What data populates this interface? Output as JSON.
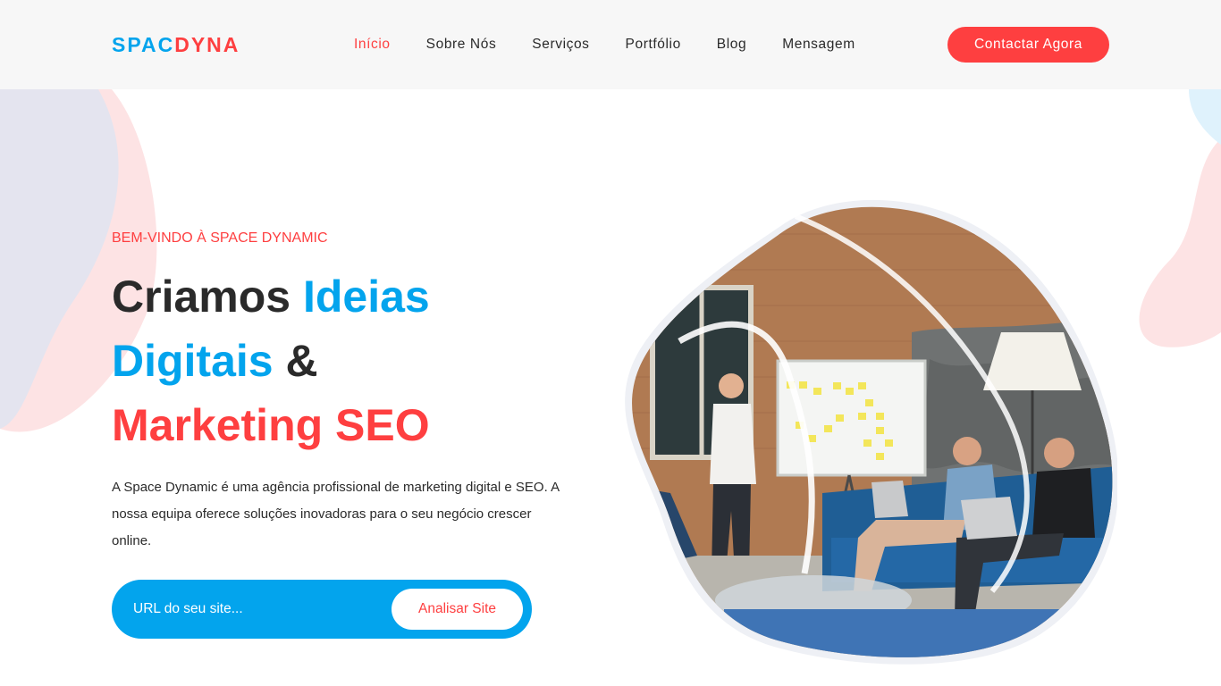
{
  "brand": {
    "logo_part1": "SPAC",
    "logo_part2": "DYNA"
  },
  "nav": {
    "items": [
      {
        "label": "Início",
        "active": true
      },
      {
        "label": "Sobre Nós",
        "active": false
      },
      {
        "label": "Serviços",
        "active": false
      },
      {
        "label": "Portfólio",
        "active": false
      },
      {
        "label": "Blog",
        "active": false
      },
      {
        "label": "Mensagem",
        "active": false
      }
    ],
    "cta_label": "Contactar Agora"
  },
  "hero": {
    "eyebrow": "BEM-VINDO À SPACE DYNAMIC",
    "title": {
      "part1": "Criamos ",
      "part2": "Ideias",
      "part3": "Digitais",
      "part4": " &",
      "part5": "Marketing SEO"
    },
    "description": "A Space Dynamic é uma agência profissional de marketing digital e SEO. A nossa equipa oferece soluções inovadoras para o seu negócio crescer online.",
    "form": {
      "placeholder": "URL do seu site...",
      "button_label": "Analisar Site"
    }
  },
  "colors": {
    "accent_red": "#fe3f40",
    "accent_blue": "#03a4ed",
    "text_dark": "#2a2a2a",
    "header_bg": "#f7f7f7"
  },
  "icons": {
    "hero_image": "team-meeting-office-photo"
  }
}
